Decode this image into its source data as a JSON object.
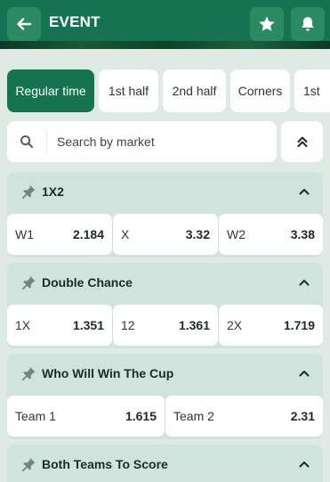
{
  "header": {
    "title": "EVENT",
    "back_icon": "arrow-left-icon",
    "favorite_icon": "star-icon",
    "notify_icon": "bell-icon"
  },
  "tabs": [
    {
      "label": "Regular time",
      "active": true
    },
    {
      "label": "1st half",
      "active": false
    },
    {
      "label": "2nd half",
      "active": false
    },
    {
      "label": "Corners",
      "active": false
    },
    {
      "label": "1st",
      "active": false
    }
  ],
  "search": {
    "placeholder": "Search by market",
    "icon": "search-icon",
    "collapse_icon": "double-chevron-up-icon"
  },
  "markets": [
    {
      "name": "1X2",
      "outcomes": [
        {
          "label": "W1",
          "odds": "2.184"
        },
        {
          "label": "X",
          "odds": "3.32"
        },
        {
          "label": "W2",
          "odds": "3.38"
        }
      ]
    },
    {
      "name": "Double Chance",
      "outcomes": [
        {
          "label": "1X",
          "odds": "1.351"
        },
        {
          "label": "12",
          "odds": "1.361"
        },
        {
          "label": "2X",
          "odds": "1.719"
        }
      ]
    },
    {
      "name": "Who Will Win The Cup",
      "outcomes": [
        {
          "label": "Team 1",
          "odds": "1.615"
        },
        {
          "label": "Team 2",
          "odds": "2.31"
        }
      ]
    },
    {
      "name": "Both Teams To Score",
      "outcomes": []
    }
  ],
  "colors": {
    "brand": "#167352",
    "brand_button": "#2b8a63",
    "page_bg": "#dfeae5",
    "market_bg": "#d0e3dc"
  }
}
